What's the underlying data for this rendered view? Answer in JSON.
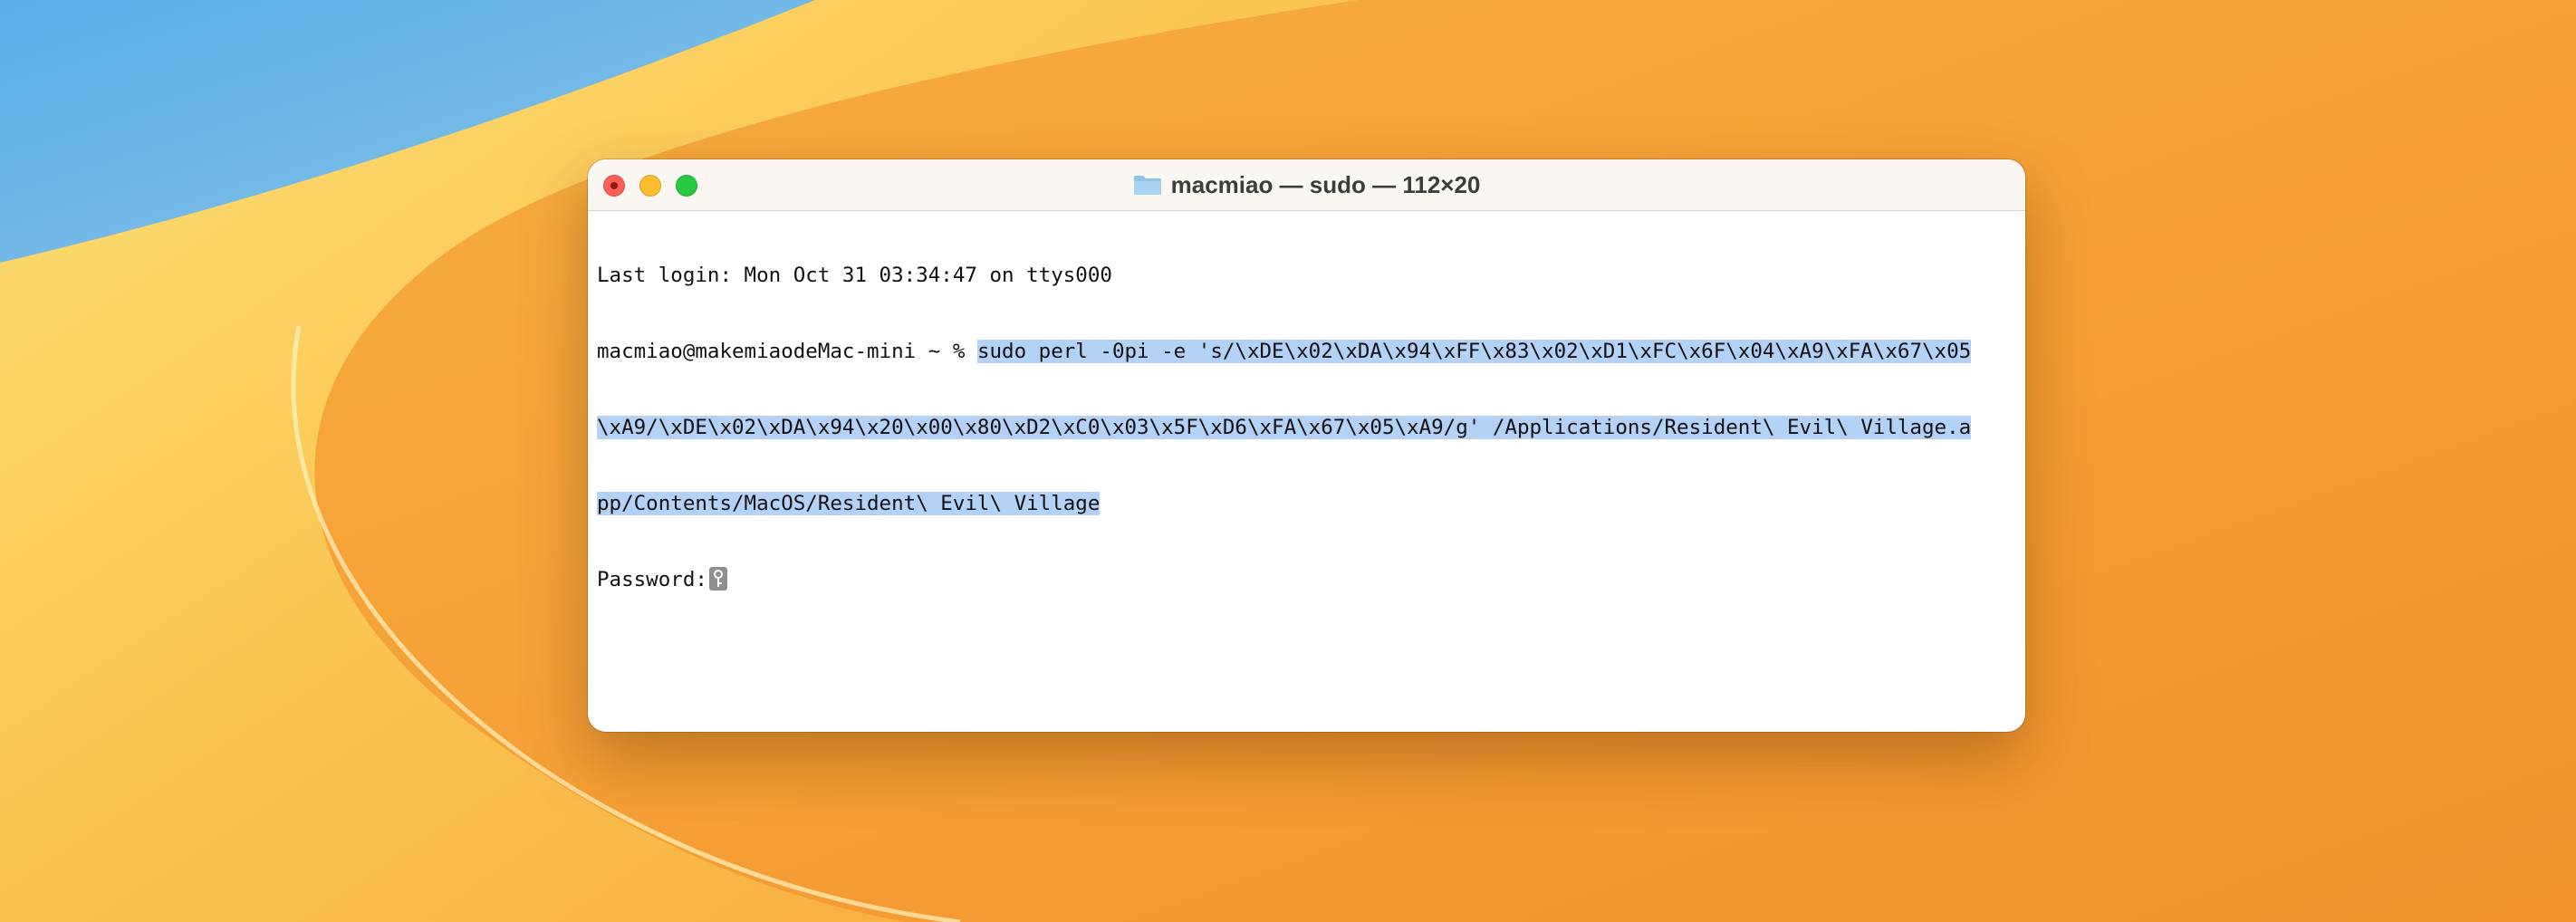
{
  "window": {
    "title": "macmiao — sudo — 112×20"
  },
  "terminal": {
    "last_login": "Last login: Mon Oct 31 03:34:47 on ttys000",
    "prompt": "macmiao@makemiaodeMac-mini ~ % ",
    "command_line1": "sudo perl -0pi -e 's/\\xDE\\x02\\xDA\\x94\\xFF\\x83\\x02\\xD1\\xFC\\x6F\\x04\\xA9\\xFA\\x67\\x05",
    "command_line2": "\\xA9/\\xDE\\x02\\xDA\\x94\\x20\\x00\\x80\\xD2\\xC0\\x03\\x5F\\xD6\\xFA\\x67\\x05\\xA9/g' /Applications/Resident\\ Evil\\ Village.a",
    "command_line3": "pp/Contents/MacOS/Resident\\ Evil\\ Village",
    "password_label": "Password:"
  },
  "icons": {
    "window_icon": "folder-icon",
    "cursor": "key-icon"
  },
  "colors": {
    "selection": "#b4d2f6",
    "close": "#fe5f57",
    "minimize": "#febc2e",
    "zoom": "#28c840"
  }
}
